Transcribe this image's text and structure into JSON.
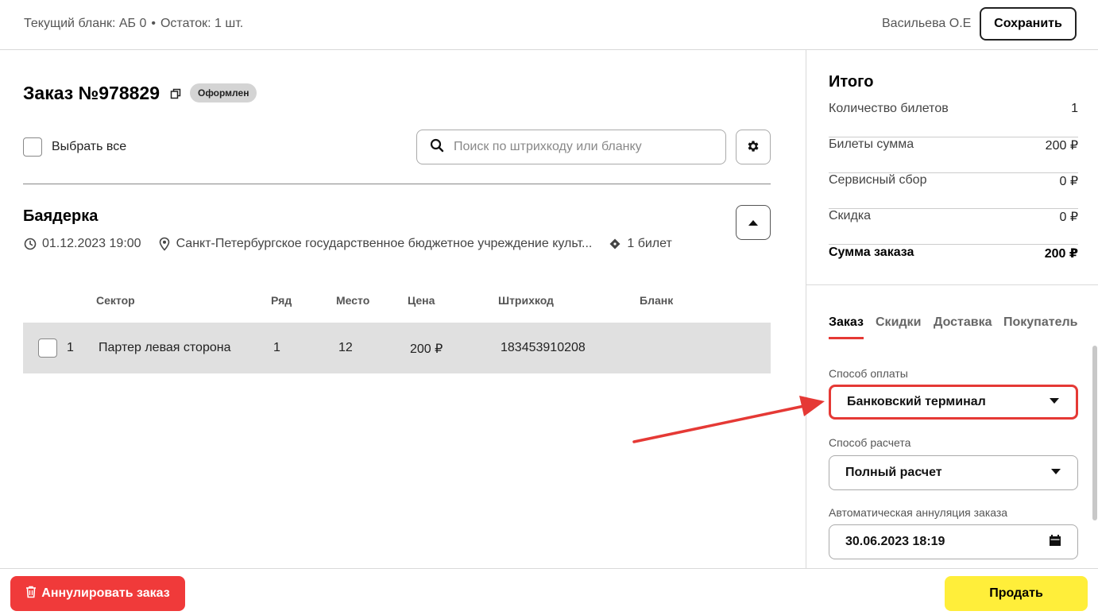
{
  "header": {
    "blank_label": "Текущий бланк: АБ 0",
    "dot": "•",
    "remaining_label": "Остаток: 1 шт.",
    "user_name": "Васильева О.Е",
    "save_label": "Сохранить"
  },
  "order": {
    "title": "Заказ №978829",
    "status": "Оформлен",
    "select_all_label": "Выбрать все",
    "search_placeholder": "Поиск по штрихкоду или бланку"
  },
  "event": {
    "title": "Баядерка",
    "datetime": "01.12.2023 19:00",
    "venue": "Санкт-Петербургское государственное бюджетное учреждение культ...",
    "tickets_count": "1 билет"
  },
  "table": {
    "headers": [
      "Сектор",
      "Ряд",
      "Место",
      "Цена",
      "Штрихкод",
      "Бланк"
    ],
    "rows": [
      {
        "index": "1",
        "sector": "Партер левая сторона",
        "row": "1",
        "seat": "12",
        "price": "200 ₽",
        "barcode": "183453910208",
        "blank": ""
      }
    ]
  },
  "summary": {
    "title": "Итого",
    "rows": [
      {
        "label": "Количество билетов",
        "value": "1"
      },
      {
        "label": "Билеты сумма",
        "value": "200 ₽"
      },
      {
        "label": "Сервисный сбор",
        "value": "0 ₽"
      },
      {
        "label": "Скидка",
        "value": "0 ₽"
      }
    ],
    "total_label": "Сумма заказа",
    "total_value": "200 ₽"
  },
  "tabs": [
    {
      "label": "Заказ",
      "active": true
    },
    {
      "label": "Скидки",
      "active": false
    },
    {
      "label": "Доставка",
      "active": false
    },
    {
      "label": "Покупатель",
      "active": false
    }
  ],
  "form": {
    "payment_method_label": "Способ оплаты",
    "payment_method_value": "Банковский терминал",
    "settlement_label": "Способ расчета",
    "settlement_value": "Полный расчет",
    "auto_cancel_label": "Автоматическая аннуляция заказа",
    "auto_cancel_value": "30.06.2023 18:19"
  },
  "footer": {
    "cancel_label": "Аннулировать заказ",
    "sell_label": "Продать"
  },
  "colors": {
    "accent_red": "#e53935",
    "cancel_red": "#f03a3a",
    "sell_yellow": "#ffee3a",
    "row_gray": "#e0e0e0"
  },
  "icons": [
    "copy-icon",
    "search-icon",
    "gear-icon",
    "chevron-up-icon",
    "clock-icon",
    "location-pin-icon",
    "ticket-icon",
    "chevron-down-icon",
    "calendar-icon",
    "trash-icon",
    "annotation-arrow-icon"
  ]
}
